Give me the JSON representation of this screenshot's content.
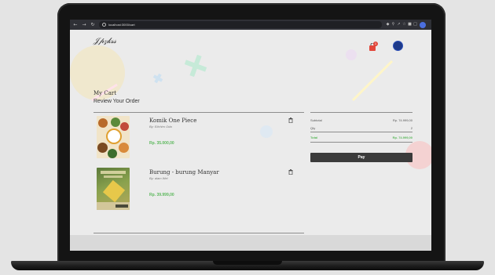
{
  "browser": {
    "url": "localhost:3000/cart"
  },
  "header": {
    "logo_text": "𝒥𝓅𝓏𝓀𝓈𝓈",
    "cart_count": "1"
  },
  "cart": {
    "title": "My Cart",
    "subtitle": "Review Your Order",
    "items": [
      {
        "name": "Komik One Piece",
        "author": "By: Eiichiro Oda",
        "price": "Rp. 35.000,00"
      },
      {
        "name": "Burung - burung Manyar",
        "author": "By: alam Wei",
        "price": "Rp. 39.999,00"
      }
    ]
  },
  "summary": {
    "subtotal_label": "Subtotal",
    "subtotal_value": "Rp. 74.999,00",
    "qty_label": "Qty",
    "qty_value": "2",
    "total_label": "Total",
    "total_value": "Rp. 74.999,00",
    "pay_label": "Pay"
  },
  "colors": {
    "accent_green": "#5cb85c",
    "pay_button": "#3b3b3b",
    "badge": "#e2473b"
  }
}
